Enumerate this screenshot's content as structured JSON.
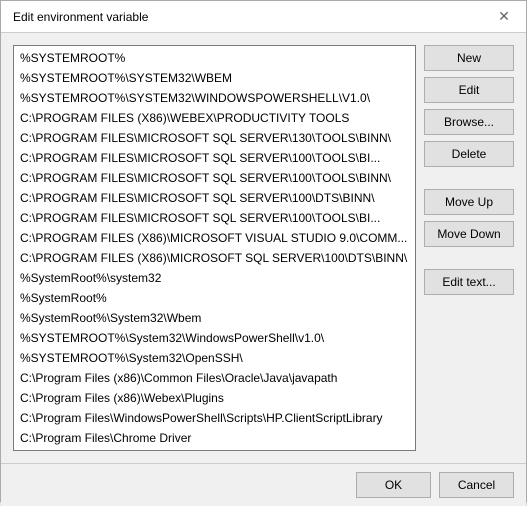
{
  "dialog": {
    "title": "Edit environment variable",
    "close_label": "✕"
  },
  "list": {
    "items": [
      {
        "id": 0,
        "text": "%SYSTEMROOT%",
        "selected": false
      },
      {
        "id": 1,
        "text": "%SYSTEMROOT%\\SYSTEM32\\WBEM",
        "selected": false
      },
      {
        "id": 2,
        "text": "%SYSTEMROOT%\\SYSTEM32\\WINDOWSPOWERSHELL\\V1.0\\",
        "selected": false
      },
      {
        "id": 3,
        "text": "C:\\PROGRAM FILES (X86)\\WEBEX\\PRODUCTIVITY TOOLS",
        "selected": false
      },
      {
        "id": 4,
        "text": "C:\\PROGRAM FILES\\MICROSOFT SQL SERVER\\130\\TOOLS\\BINN\\",
        "selected": false
      },
      {
        "id": 5,
        "text": "C:\\PROGRAM FILES\\MICROSOFT SQL SERVER\\100\\TOOLS\\BI...",
        "selected": false
      },
      {
        "id": 6,
        "text": "C:\\PROGRAM FILES\\MICROSOFT SQL SERVER\\100\\TOOLS\\BINN\\",
        "selected": false
      },
      {
        "id": 7,
        "text": "C:\\PROGRAM FILES\\MICROSOFT SQL SERVER\\100\\DTS\\BINN\\",
        "selected": false
      },
      {
        "id": 8,
        "text": "C:\\PROGRAM FILES\\MICROSOFT SQL SERVER\\100\\TOOLS\\BI...",
        "selected": false
      },
      {
        "id": 9,
        "text": "C:\\PROGRAM FILES (X86)\\MICROSOFT VISUAL STUDIO 9.0\\COMM...",
        "selected": false
      },
      {
        "id": 10,
        "text": "C:\\PROGRAM FILES (X86)\\MICROSOFT SQL SERVER\\100\\DTS\\BINN\\",
        "selected": false
      },
      {
        "id": 11,
        "text": "%SystemRoot%\\system32",
        "selected": false
      },
      {
        "id": 12,
        "text": "%SystemRoot%",
        "selected": false
      },
      {
        "id": 13,
        "text": "%SystemRoot%\\System32\\Wbem",
        "selected": false
      },
      {
        "id": 14,
        "text": "%SYSTEMROOT%\\System32\\WindowsPowerShell\\v1.0\\",
        "selected": false
      },
      {
        "id": 15,
        "text": "%SYSTEMROOT%\\System32\\OpenSSH\\",
        "selected": false
      },
      {
        "id": 16,
        "text": "C:\\Program Files (x86)\\Common Files\\Oracle\\Java\\javapath",
        "selected": false
      },
      {
        "id": 17,
        "text": "C:\\Program Files (x86)\\Webex\\Plugins",
        "selected": false
      },
      {
        "id": 18,
        "text": "C:\\Program Files\\WindowsPowerShell\\Scripts\\HP.ClientScriptLibrary",
        "selected": false
      },
      {
        "id": 19,
        "text": "C:\\Program Files\\Chrome Driver",
        "selected": false
      }
    ]
  },
  "buttons": {
    "new_label": "New",
    "edit_label": "Edit",
    "browse_label": "Browse...",
    "delete_label": "Delete",
    "move_up_label": "Move Up",
    "move_down_label": "Move Down",
    "edit_text_label": "Edit text..."
  },
  "footer": {
    "ok_label": "OK",
    "cancel_label": "Cancel"
  }
}
